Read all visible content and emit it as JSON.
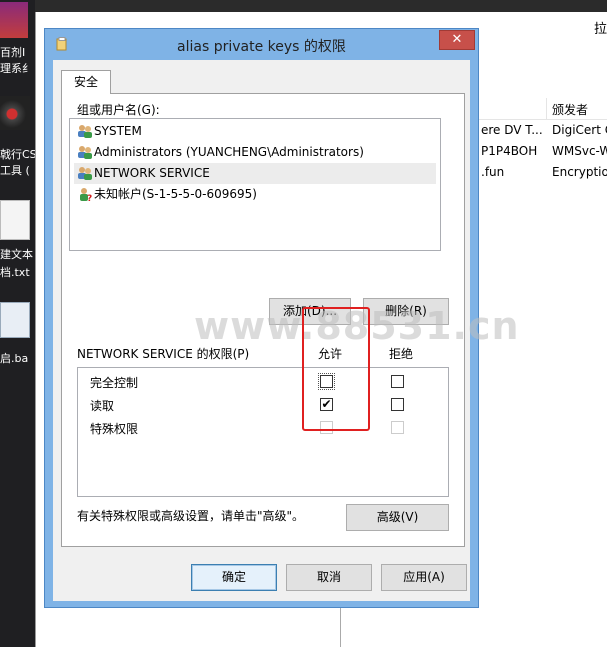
{
  "dialog": {
    "title": "alias private keys 的权限",
    "close_symbol": "✕",
    "tab_label": "安全",
    "group_label": "组或用户名(G):",
    "users": [
      {
        "name": "SYSTEM",
        "icon": "users-group-icon",
        "selected": false
      },
      {
        "name": "Administrators (YUANCHENG\\Administrators)",
        "icon": "users-group-icon",
        "selected": false
      },
      {
        "name": "NETWORK SERVICE",
        "icon": "users-group-icon",
        "selected": true
      },
      {
        "name": "未知帐户(S-1-5-5-0-609695)",
        "icon": "unknown-user-icon",
        "selected": false
      }
    ],
    "add_button": "添加(D)...",
    "remove_button": "删除(R)",
    "perm_label": "NETWORK SERVICE 的权限(P)",
    "allow_header": "允许",
    "deny_header": "拒绝",
    "permissions": [
      {
        "name": "完全控制",
        "allow": false,
        "deny": false,
        "disabled": false
      },
      {
        "name": "读取",
        "allow": true,
        "deny": false,
        "disabled": false
      },
      {
        "name": "特殊权限",
        "allow": false,
        "deny": false,
        "disabled": true
      }
    ],
    "advanced_hint": "有关特殊权限或高级设置，请单击\"高级\"。",
    "advanced_button": "高级(V)",
    "ok_button": "确定",
    "cancel_button": "取消",
    "apply_button": "应用(A)"
  },
  "background": {
    "header_col": "颁发者",
    "top_right_char": "拉",
    "rows": [
      {
        "left": "ere DV T...",
        "right": "DigiCert G"
      },
      {
        "left": "P1P4BOH",
        "right": "WMSvc-W"
      },
      {
        "left": ".fun",
        "right": "Encryptio"
      }
    ],
    "desktop_labels": [
      "百剂I",
      "理系纟",
      "戟行CS",
      "工具 (",
      "建文本",
      "档.txt",
      "启.ba"
    ]
  },
  "watermark": "www.88531.cn",
  "colors": {
    "titlebar": "#7fb3e6",
    "close": "#c7504a",
    "highlight": "#e02020"
  }
}
